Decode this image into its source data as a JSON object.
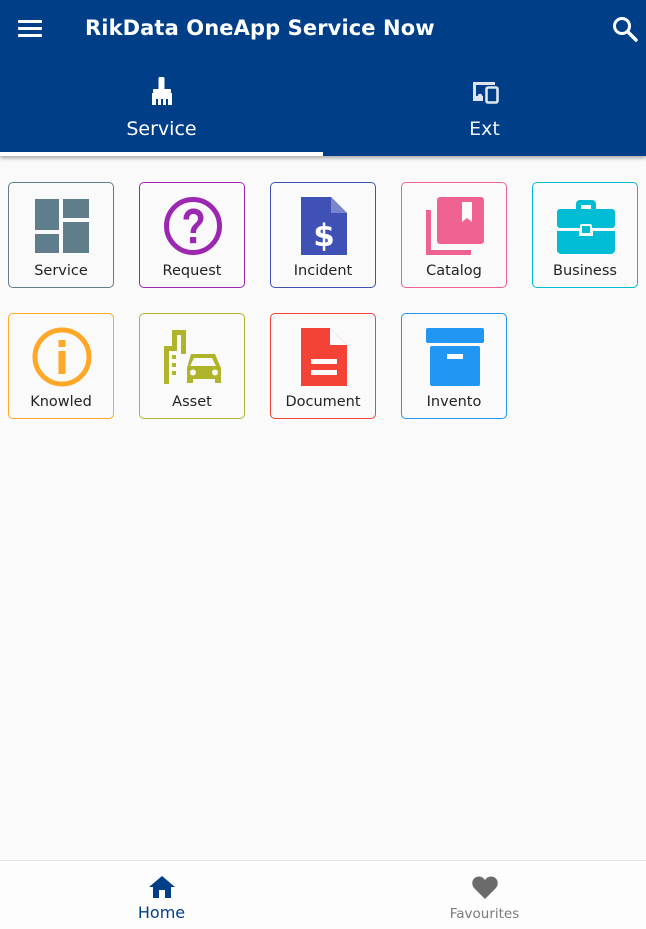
{
  "header": {
    "title": "RikData OneApp Service Now",
    "menu_icon": "menu-icon",
    "search_icon": "search-icon",
    "background": "#003f88"
  },
  "tabs": [
    {
      "label": "Service",
      "icon": "broom-icon",
      "selected": true
    },
    {
      "label": "Ext",
      "icon": "devices-icon",
      "selected": false
    }
  ],
  "tiles": [
    {
      "label": "Service",
      "icon": "dashboard-icon",
      "color": "#607d8b"
    },
    {
      "label": "Request",
      "icon": "help-circle-icon",
      "color": "#9c27b0"
    },
    {
      "label": "Incident",
      "icon": "invoice-dollar-icon",
      "color": "#3f51b5"
    },
    {
      "label": "Catalog",
      "icon": "library-books-icon",
      "color": "#f06292"
    },
    {
      "label": "Business",
      "icon": "briefcase-icon",
      "color": "#00bcd4"
    },
    {
      "label": "Knowled",
      "icon": "info-circle-icon",
      "color": "#ffa726"
    },
    {
      "label": "Asset",
      "icon": "city-car-icon",
      "color": "#afb42b"
    },
    {
      "label": "Document",
      "icon": "document-icon",
      "color": "#f44336"
    },
    {
      "label": "Invento",
      "icon": "archive-box-icon",
      "color": "#2196f3"
    }
  ],
  "bottom_nav": [
    {
      "label": "Home",
      "icon": "home-icon",
      "selected": true,
      "color": "#003f88"
    },
    {
      "label": "Favourites",
      "icon": "heart-icon",
      "selected": false,
      "color": "#6b6b6b"
    }
  ]
}
